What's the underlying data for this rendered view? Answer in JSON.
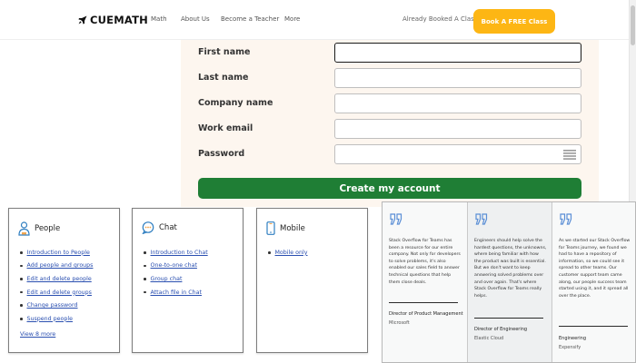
{
  "nav": {
    "logo": "CUEMATH",
    "links": [
      "Math",
      "About Us",
      "Become a Teacher",
      "More"
    ],
    "booked_text": "Already Booked A Class?",
    "cta": "Book A FREE Class"
  },
  "form": {
    "fields": [
      {
        "label": "First name",
        "value": ""
      },
      {
        "label": "Last name",
        "value": ""
      },
      {
        "label": "Company name",
        "value": ""
      },
      {
        "label": "Work email",
        "value": ""
      },
      {
        "label": "Password",
        "value": ""
      }
    ],
    "submit": "Create my account"
  },
  "cards": {
    "people": {
      "title": "People",
      "items": [
        "Introduction to People",
        "Add people and groups",
        "Edit and delete people",
        "Edit and delete groups",
        "Change password",
        "Suspend people"
      ],
      "view_more": "View 8 more"
    },
    "chat": {
      "title": "Chat",
      "items": [
        "Introduction to Chat",
        "One-to-one chat",
        "Group chat",
        "Attach file in Chat"
      ]
    },
    "mobile": {
      "title": "Mobile",
      "items": [
        "Mobile only"
      ]
    }
  },
  "testimonials": [
    {
      "quote": "Stack Overflow for Teams has been a resource for our entire company. Not only for developers to solve problems, it's also enabled our sales field to answer technical questions that help them close deals.",
      "role": "Director of Product Management",
      "company": "Microsoft"
    },
    {
      "quote": "Engineers should help solve the hardest questions, the unknowns, where being familiar with how the product was built is essential. But we don't want to keep answering solved problems over and over again. That's where Stack Overflow for Teams really helps.",
      "role": "Director of Engineering",
      "company": "Elastic Cloud"
    },
    {
      "quote": "As we started our Stack Overflow for Teams journey, we found we had to have a repository of information, so we could see it spread to other teams. Our customer support team came along, our people success team started using it, and it spread all over the place.",
      "role": "Engineering",
      "company": "Expensify"
    }
  ],
  "colors": {
    "cta": "#fdb614",
    "submit": "#1f7e35",
    "form_panel": "#fdf6ef",
    "link": "#2a4fb0",
    "quote_icon": "#5b8fd6"
  }
}
